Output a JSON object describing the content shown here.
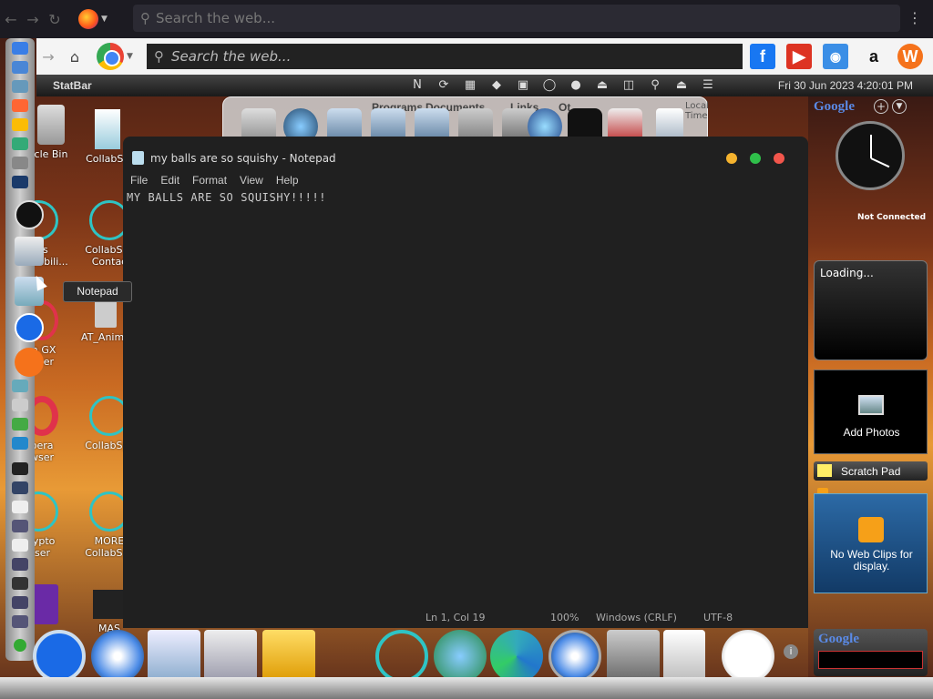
{
  "firefox": {
    "search_placeholder": "Search the web..."
  },
  "chrome": {
    "search_placeholder": "Search the web..."
  },
  "statbar": {
    "title": "StatBar",
    "clock": "Fri 30 Jun 2023 4:20:01 PM"
  },
  "quickdock": {
    "labels": [
      "Programs",
      "Documents",
      "Links",
      "Ot"
    ],
    "time_label": "Local Time"
  },
  "desktop": {
    "icons": [
      "cle Bin",
      "CollabSy",
      "ows",
      "Compabili...",
      "CollabSys",
      "Contac",
      "ra GX",
      "wser",
      "AT_Anime",
      "pera",
      "wser",
      "CollabSys",
      "Crypto",
      "wser",
      "MORE",
      "CollabSys",
      "MAS"
    ]
  },
  "notepad": {
    "title": "my balls are so squishy - Notepad",
    "menu": [
      "File",
      "Edit",
      "Format",
      "View",
      "Help"
    ],
    "content": "MY BALLS ARE SO SQUISHY!!!!!",
    "status": {
      "position": "Ln 1, Col 19",
      "zoom": "100%",
      "line_ending": "Windows (CRLF)",
      "encoding": "UTF-8"
    }
  },
  "tooltip": "Notepad",
  "gadgets": {
    "google_top": "Google",
    "network": "Not Connected",
    "loading": "Loading...",
    "add_photos": "Add Photos",
    "scratch_pad": "Scratch Pad",
    "web_clips": "No Web Clips for display.",
    "google_bottom": "Google"
  },
  "colors": {
    "accent_teal": "#2ec4c4",
    "sidebar_dark": "#202020"
  }
}
